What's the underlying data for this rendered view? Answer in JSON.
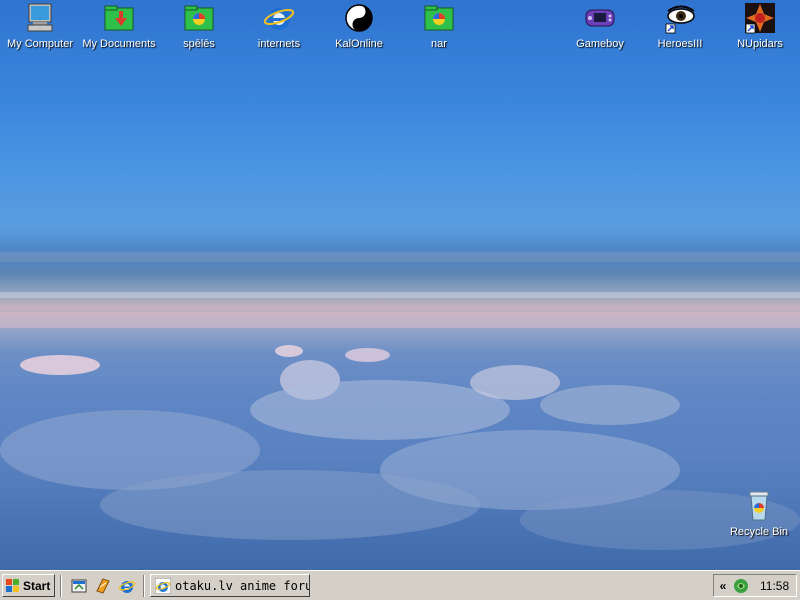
{
  "desktop": {
    "icons": [
      {
        "label": "My Computer",
        "icon": "my-computer-icon"
      },
      {
        "label": "My Documents",
        "icon": "my-documents-icon"
      },
      {
        "label": "spēlēs",
        "icon": "folder-spēlēs-icon"
      },
      {
        "label": "internets",
        "icon": "internet-explorer-icon"
      },
      {
        "label": "KalOnline",
        "icon": "kalonline-icon"
      },
      {
        "label": "nar",
        "icon": "folder-nar-icon"
      },
      {
        "label": "Gameboy",
        "icon": "gameboy-icon"
      },
      {
        "label": "HeroesIII",
        "icon": "heroes-iii-icon"
      },
      {
        "label": "NUpidars",
        "icon": "nupidars-icon"
      },
      {
        "label": "Recycle Bin",
        "icon": "recycle-bin-icon"
      }
    ]
  },
  "taskbar": {
    "start_label": "Start",
    "quick_launch": [
      "show-desktop-icon",
      "media-icon",
      "internet-explorer-icon"
    ],
    "active_task": {
      "label": "otaku.lv anime foru...",
      "icon": "internet-explorer-icon"
    },
    "tray": {
      "chevron": "«",
      "app_icon": "tray-app-icon",
      "clock": "11:58"
    }
  },
  "colors": {
    "taskbar": "#d4d0c8",
    "sky_top": "#2f74cf",
    "ie_blue": "#1d6fd1"
  }
}
